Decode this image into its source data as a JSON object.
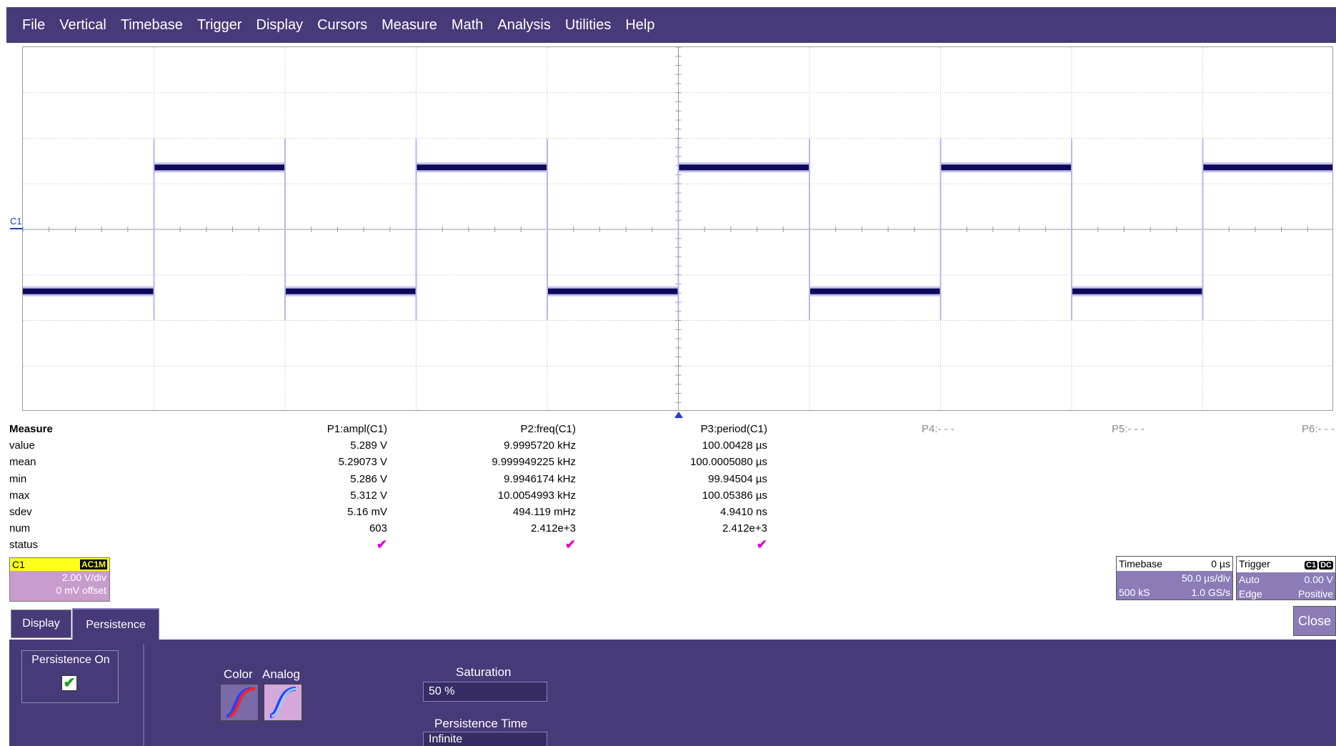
{
  "menu": [
    "File",
    "Vertical",
    "Timebase",
    "Trigger",
    "Display",
    "Cursors",
    "Measure",
    "Math",
    "Analysis",
    "Utilities",
    "Help"
  ],
  "channel_marker": "C1",
  "measure": {
    "title": "Measure",
    "row_labels": [
      "value",
      "mean",
      "min",
      "max",
      "sdev",
      "num",
      "status"
    ],
    "params": [
      {
        "header": "P1:ampl(C1)",
        "values": [
          "5.289 V",
          "5.29073 V",
          "5.286 V",
          "5.312 V",
          "5.16 mV",
          "603"
        ],
        "status": "✔"
      },
      {
        "header": "P2:freq(C1)",
        "values": [
          "9.9995720 kHz",
          "9.999949225 kHz",
          "9.9946174 kHz",
          "10.0054993 kHz",
          "494.119 mHz",
          "2.412e+3"
        ],
        "status": "✔"
      },
      {
        "header": "P3:period(C1)",
        "values": [
          "100.00428 µs",
          "100.0005080 µs",
          "99.94504 µs",
          "100.05386 µs",
          "4.9410 ns",
          "2.412e+3"
        ],
        "status": "✔"
      }
    ],
    "empty_params": [
      "P4:- - -",
      "P5:- - -",
      "P6:- - -"
    ]
  },
  "channel_box": {
    "name": "C1",
    "coupling": "AC1M",
    "vdiv": "2.00 V/div",
    "offset": "0 mV offset"
  },
  "timebase_box": {
    "label": "Timebase",
    "delay": "0 µs",
    "tdiv": "50.0 µs/div",
    "samples": "500 kS",
    "rate": "1.0 GS/s"
  },
  "trigger_box": {
    "label": "Trigger",
    "badge1": "C1",
    "badge2": "DC",
    "mode": "Auto",
    "level": "0.00 V",
    "type": "Edge",
    "slope": "Positive"
  },
  "tabs": {
    "display": "Display",
    "persistence": "Persistence"
  },
  "close_label": "Close",
  "panel": {
    "persistence_on_label": "Persistence On",
    "color_label": "Color",
    "analog_label": "Analog",
    "saturation_label": "Saturation",
    "saturation_value": "50 %",
    "persistence_time_label": "Persistence Time",
    "persistence_time_value": "Infinite"
  }
}
